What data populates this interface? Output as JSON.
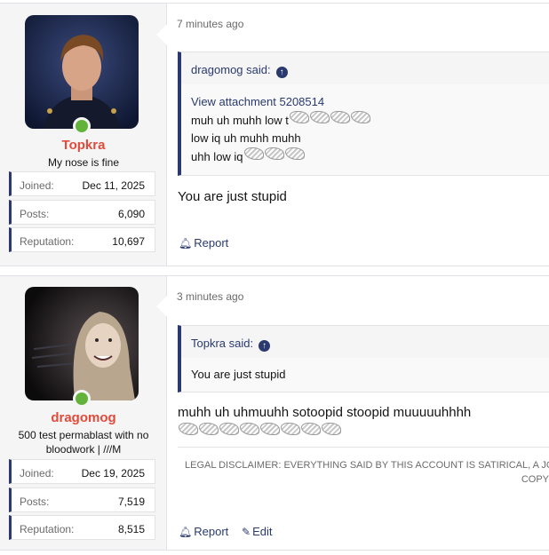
{
  "posts": [
    {
      "user": {
        "name": "Topkra",
        "title": "My nose is fine",
        "stats": [
          {
            "label": "Joined:",
            "value": "Dec 11, 2025"
          },
          {
            "label": "Posts:",
            "value": "6,090"
          },
          {
            "label": "Reputation:",
            "value": "10,697"
          }
        ]
      },
      "time": "7 minutes ago",
      "quote": {
        "author": "dragomog said:",
        "attachment": "View attachment 5208514",
        "lines": [
          "muh uh muhh low t",
          "low iq uh muhh muhh",
          "uhh low iq"
        ]
      },
      "message": "You are just stupid",
      "actions": {
        "report": "Report"
      }
    },
    {
      "user": {
        "name": "dragomog",
        "title": "500 test permablast with no bloodwork | ///M",
        "stats": [
          {
            "label": "Joined:",
            "value": "Dec 19, 2025"
          },
          {
            "label": "Posts:",
            "value": "7,519"
          },
          {
            "label": "Reputation:",
            "value": "8,515"
          }
        ]
      },
      "time": "3 minutes ago",
      "quote": {
        "author": "Topkra said:",
        "text": "You are just stupid"
      },
      "message": "muhh uh uhmuuhh sotoopid stoopid muuuuuhhhh",
      "disclaimer": {
        "line1": "LEGAL DISCLAIMER: EVERYTHING SAID BY THIS ACCOUNT IS SATIRICAL, A JOKE",
        "line2": "COPY"
      },
      "actions": {
        "report": "Report",
        "edit": "Edit"
      }
    }
  ],
  "colors": {
    "accent": "#2a3a6e",
    "username": "#e24a3b",
    "online": "#63b33a"
  },
  "icons": {
    "report": "bell-icon",
    "edit": "pencil-icon",
    "quote_jump": "arrow-up-circle-icon",
    "emote": "laughing-emote-icon"
  }
}
